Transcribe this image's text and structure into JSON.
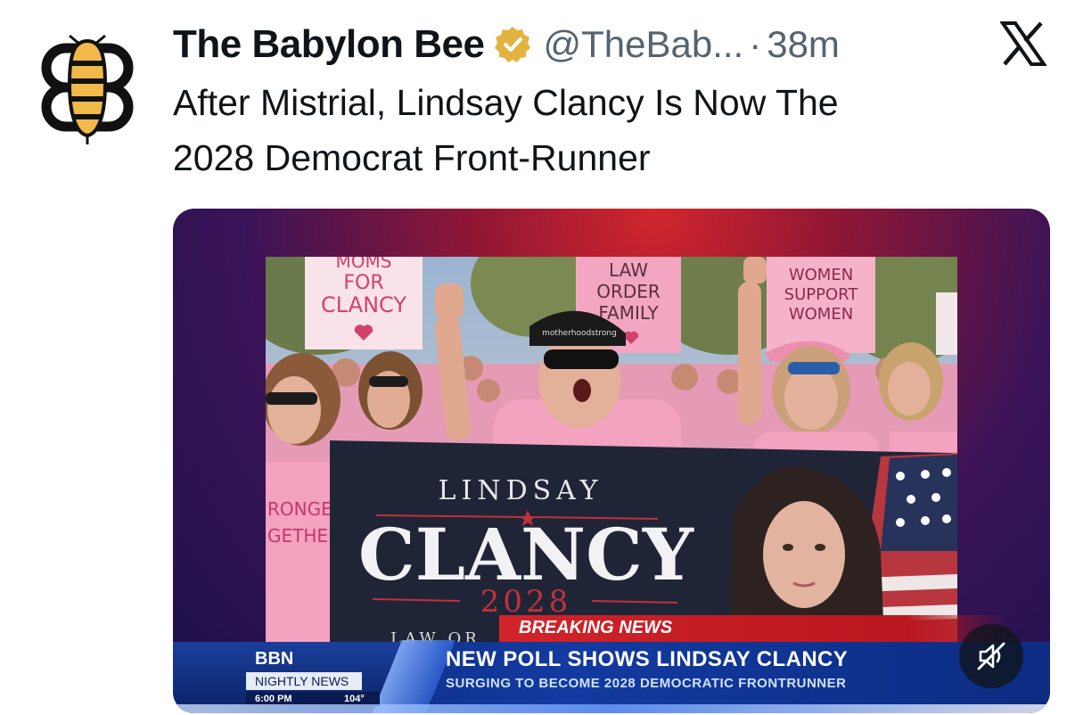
{
  "tweet": {
    "author_name": "The Babylon Bee",
    "handle": "@TheBab...",
    "separator": "·",
    "time": "38m",
    "text_line1": "After Mistrial, Lindsay Clancy Is Now The",
    "text_line2": "2028 Democrat Front-Runner"
  },
  "icons": {
    "avatar": "babylon-bee-logo",
    "verified": "gold-verified-badge",
    "platform": "x-logo",
    "mute": "speaker-muted-icon"
  },
  "media": {
    "signs": {
      "moms_for_clancy": [
        "MOMS",
        "FOR",
        "CLANCY"
      ],
      "law_order_family": [
        "LAW",
        "ORDER",
        "FAMILY"
      ],
      "women_support_women": [
        "WOMEN",
        "SUPPORT",
        "WOMEN"
      ],
      "stronger_together": [
        "RONGER",
        "GETHER"
      ]
    },
    "cap_text": "motherhoodstrong",
    "banner": {
      "top": "LINDSAY",
      "name": "CLANCY",
      "year": "2028",
      "bottom": "LAW OR"
    },
    "news": {
      "breaking": "BREAKING NEWS",
      "network": "BBN",
      "program": "NIGHTLY NEWS",
      "clock": "6:00 PM",
      "weather": "104°",
      "headline": "NEW POLL SHOWS LINDSAY CLANCY",
      "subheadline": "SURGING TO BECOME 2028 DEMOCRATIC FRONTRUNNER"
    }
  },
  "colors": {
    "text_primary": "#0f1419",
    "text_secondary": "#536471",
    "verified_gold": "#e2b33e",
    "breaking_red": "#d2242a",
    "news_blue": "#123aa0",
    "shirt_pink": "#f1a7c2"
  }
}
